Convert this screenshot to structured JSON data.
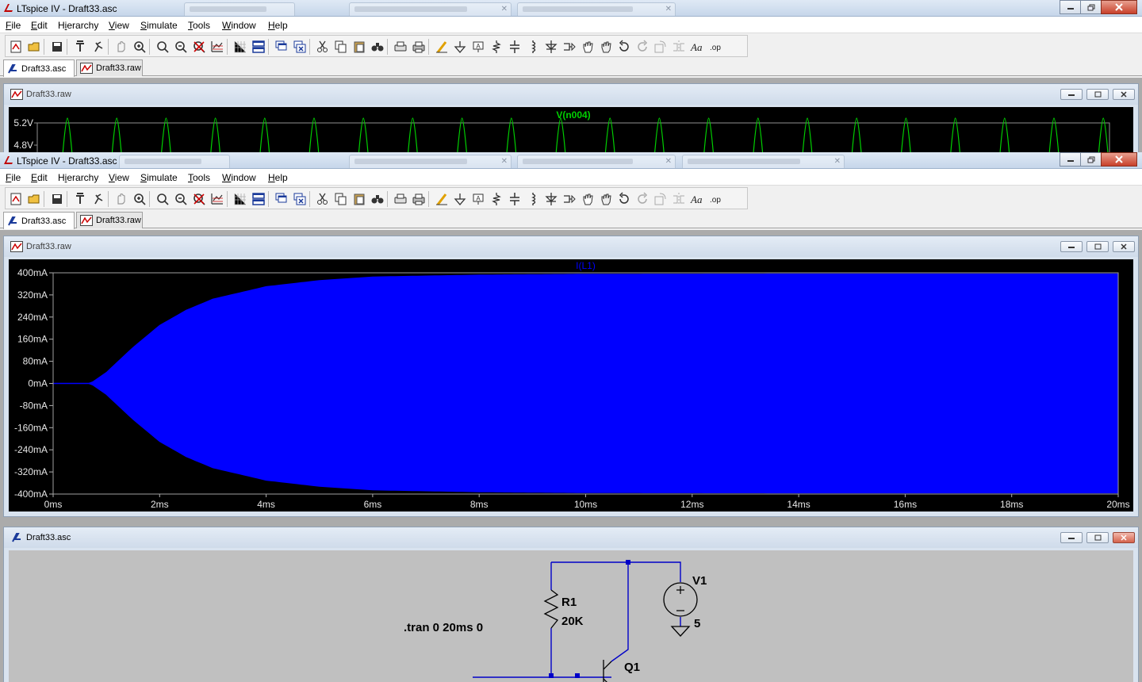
{
  "app": {
    "title": "LTspice IV - Draft33.asc",
    "menu": [
      "File",
      "Edit",
      "Hierarchy",
      "View",
      "Simulate",
      "Tools",
      "Window",
      "Help"
    ],
    "menu_mnemonics": [
      "F",
      "E",
      "i",
      "V",
      "S",
      "T",
      "W",
      "H"
    ],
    "tabs": [
      {
        "label": "Draft33.asc",
        "icon": "schematic-icon",
        "active": true
      },
      {
        "label": "Draft33.raw",
        "icon": "waveform-icon",
        "active": false
      }
    ]
  },
  "toolbar_icons": [
    "new-schematic-icon",
    "open-icon",
    "save-icon",
    "control-panel-icon",
    "run-icon",
    "halt-icon",
    "zoom-in-icon",
    "zoom-area-icon",
    "zoom-out-icon",
    "zoom-cancel-icon",
    "autorange-icon",
    "grid-toggle-icon",
    "tile-horizontal-icon",
    "cascade-icon",
    "close-all-icon",
    "cut-icon",
    "copy-icon",
    "paste-icon",
    "find-icon",
    "print-preview-icon",
    "print-icon",
    "draw-wire-icon",
    "ground-icon",
    "label-net-icon",
    "resistor-icon",
    "capacitor-icon",
    "inductor-icon",
    "diode-icon",
    "component-icon",
    "move-icon",
    "drag-icon",
    "undo-icon",
    "redo-icon",
    "rotate-icon",
    "mirror-icon",
    "text-icon",
    "spice-directive-icon"
  ],
  "top_plot": {
    "window_title": "Draft33.raw",
    "trace_label": "V(n004)",
    "trace_color": "#00d000",
    "y_ticks": [
      "5.2V",
      "4.8V"
    ],
    "pulse_count": 22
  },
  "main_plot": {
    "window_title": "Draft33.raw",
    "trace_label": "I(L1)",
    "trace_color": "#0000ff",
    "background": "#000000"
  },
  "chart_data": {
    "type": "area",
    "title": "I(L1)",
    "xlabel": "",
    "ylabel": "",
    "x_ticks": [
      "0ms",
      "2ms",
      "4ms",
      "6ms",
      "8ms",
      "10ms",
      "12ms",
      "14ms",
      "16ms",
      "18ms",
      "20ms"
    ],
    "y_ticks": [
      "400mA",
      "320mA",
      "240mA",
      "160mA",
      "80mA",
      "0mA",
      "-80mA",
      "-160mA",
      "-240mA",
      "-320mA",
      "-400mA"
    ],
    "xlim": [
      0,
      20
    ],
    "ylim": [
      -400,
      400
    ],
    "series": [
      {
        "name": "I(L1)",
        "x_ms": [
          0,
          0.7,
          1,
          1.5,
          2,
          2.5,
          3,
          4,
          5,
          6,
          8,
          10,
          14,
          20
        ],
        "envelope_mA": [
          0,
          0,
          40,
          130,
          210,
          265,
          305,
          350,
          372,
          385,
          392,
          395,
          396,
          396
        ]
      }
    ]
  },
  "schematic": {
    "window_title": "Draft33.asc",
    "directive": ".tran 0 20ms 0",
    "components": [
      {
        "ref": "R1",
        "value": "20K"
      },
      {
        "ref": "V1",
        "value": "5"
      },
      {
        "ref": "Q1",
        "value": ""
      }
    ],
    "wire_color": "#0000c8"
  }
}
